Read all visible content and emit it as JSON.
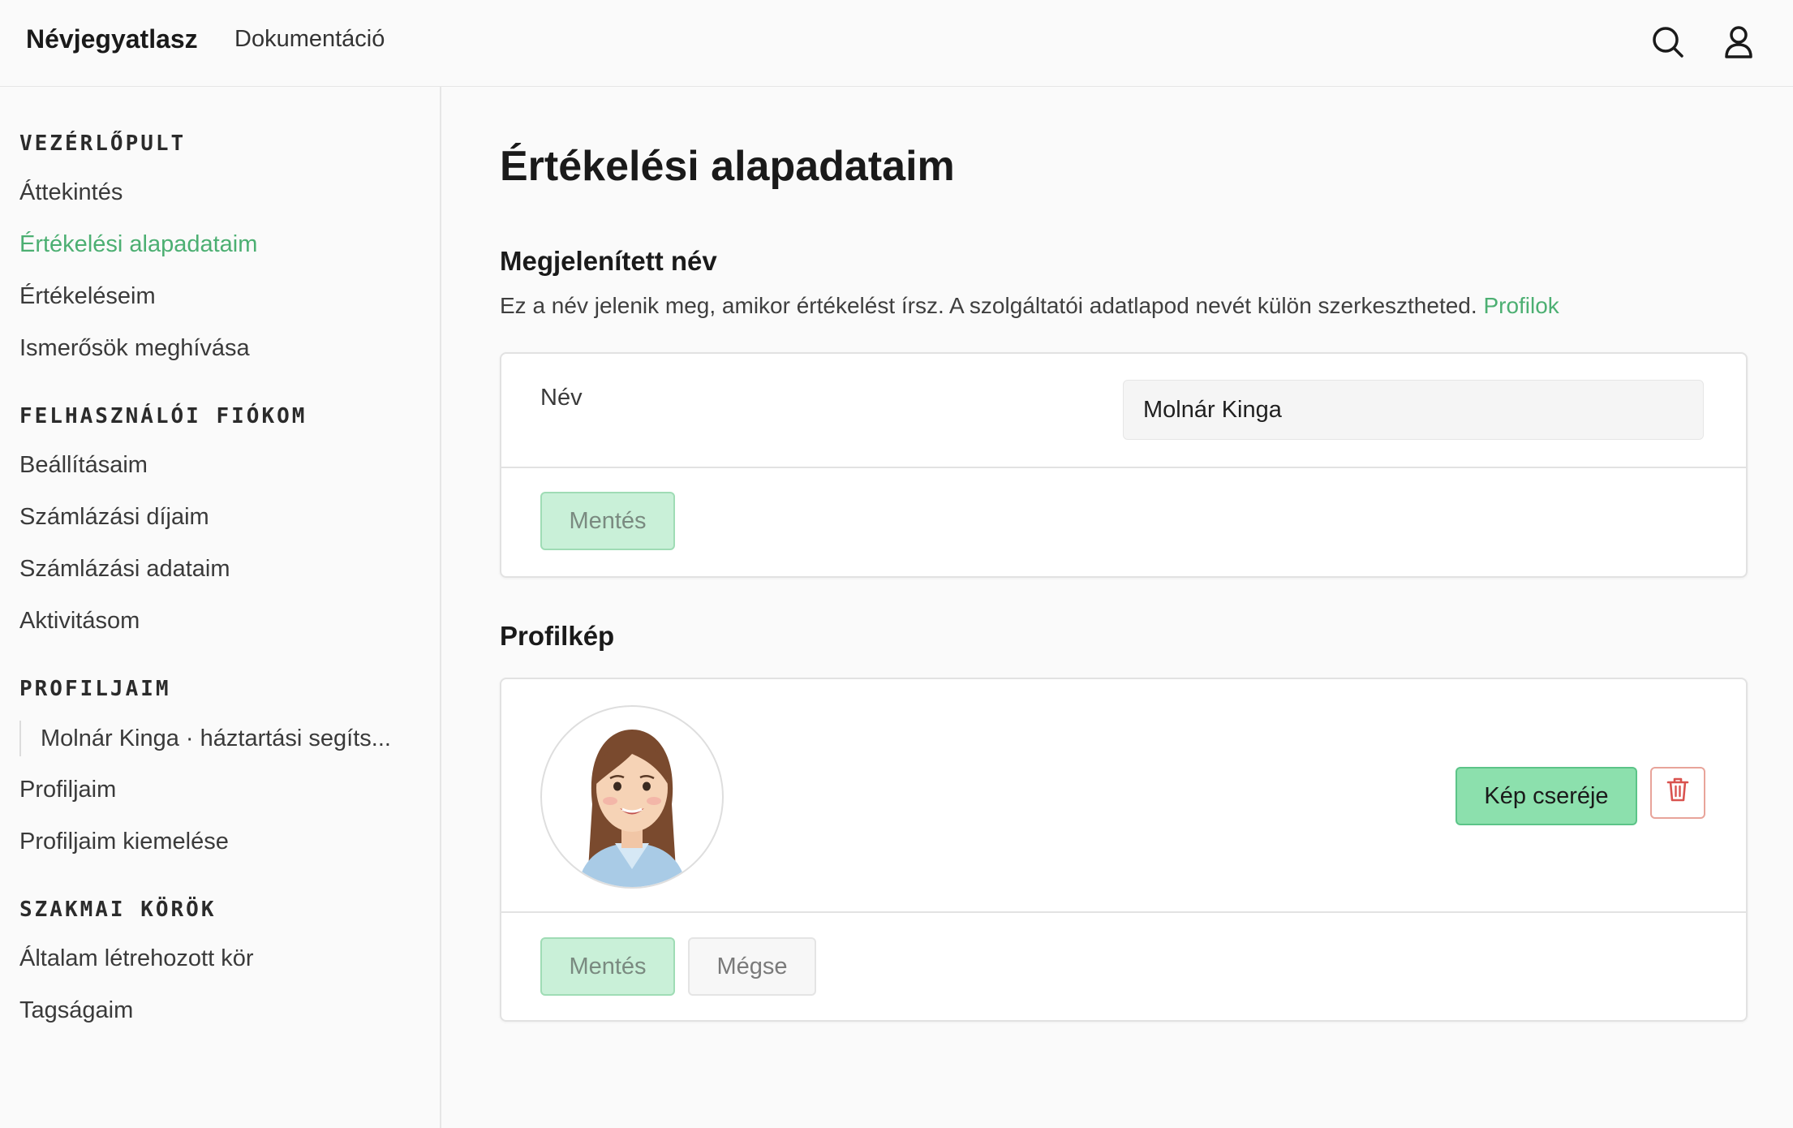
{
  "app": {
    "brand": "Névjegyatlasz",
    "docs_link": "Dokumentáció"
  },
  "header_icons": [
    "search-icon",
    "user-icon"
  ],
  "sidebar": {
    "sections": [
      {
        "title": "VEZÉRLŐPULT",
        "items": [
          "Áttekintés",
          "Értékelési alapadataim",
          "Értékeléseim",
          "Ismerősök meghívása"
        ]
      },
      {
        "title": "FELHASZNÁLÓI FIÓKOM",
        "items": [
          "Beállításaim",
          "Számlázási díjaim",
          "Számlázási adataim",
          "Aktivitásom"
        ]
      },
      {
        "title": "PROFILJAIM",
        "sub_item": "Molnár Kinga · háztartási segíts...",
        "items": [
          "Profiljaim",
          "Profiljaim kiemelése"
        ]
      },
      {
        "title": "SZAKMAI KÖRÖK",
        "items": [
          "Általam létrehozott kör",
          "Tagságaim"
        ]
      }
    ],
    "active_item": "Értékelési alapadataim"
  },
  "main": {
    "title": "Értékelési alapadataim",
    "display_name": {
      "title": "Megjelenített név",
      "description": "Ez a név jelenik meg, amikor értékelést írsz. A szolgáltatói adatlapod nevét külön szerkesztheted.",
      "link": "Profilok",
      "field_label": "Név",
      "field_value": "Molnár Kinga",
      "save_label": "Mentés"
    },
    "profile_picture": {
      "title": "Profilkép",
      "change_label": "Kép cseréje",
      "delete_icon": "trash-icon",
      "save_label": "Mentés",
      "cancel_label": "Mégse"
    }
  },
  "colors": {
    "accent": "#4caf72",
    "primary_button": "#8ce0ad",
    "danger": "#d9534f"
  }
}
